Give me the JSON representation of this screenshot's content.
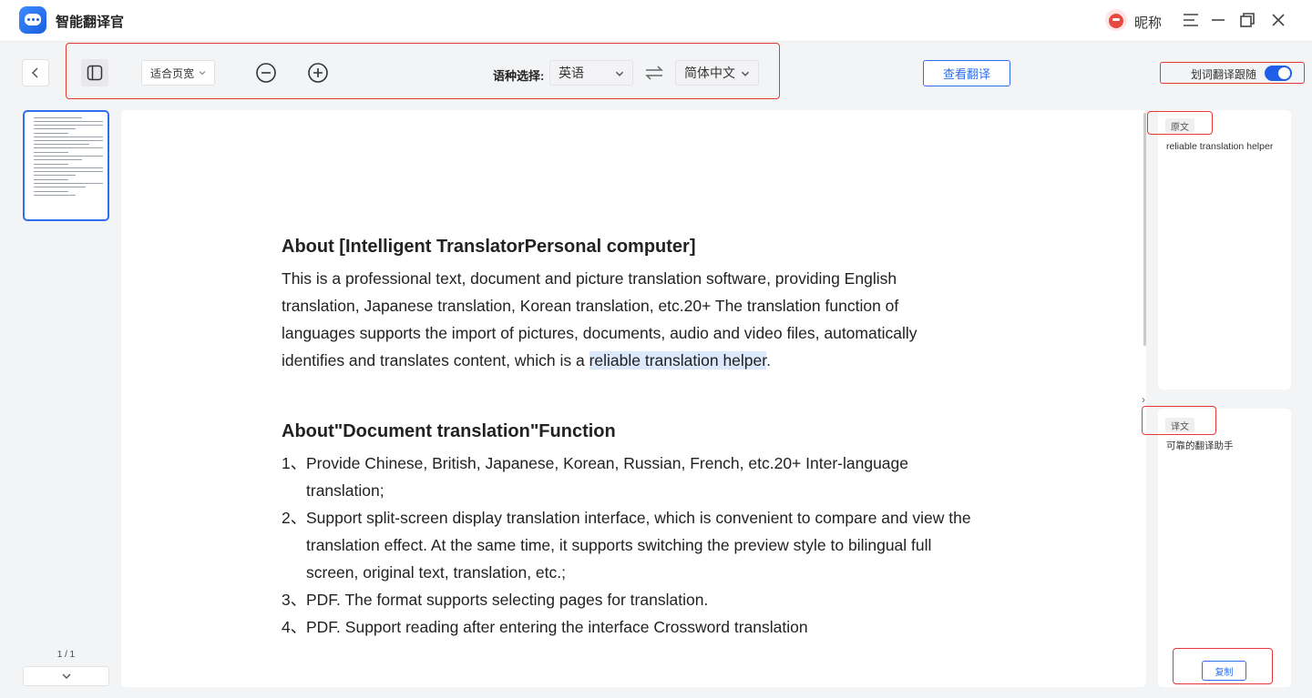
{
  "app": {
    "title": "智能翻译官",
    "user_nickname": "昵称",
    "window_buttons": [
      "menu-icon",
      "minimize-icon",
      "maximize-icon",
      "close-icon"
    ]
  },
  "toolbar": {
    "fit_mode": "适合页宽",
    "lang_label": "语种选择:",
    "source_lang": "英语",
    "target_lang": "简体中文",
    "view_translation": "查看翻译",
    "follow_label": "划词翻译跟随",
    "follow_enabled": true
  },
  "thumbnails": {
    "page_indicator": "1 / 1"
  },
  "document": {
    "section1": {
      "heading": "About [Intelligent TranslatorPersonal computer]",
      "para_before": "This is a professional text, document and picture translation software, providing English translation, Japanese translation, Korean translation, etc.20+ The translation function of languages supports the import of pictures, documents, audio and video files, automatically identifies and translates content, which is a ",
      "highlight": "reliable translation helper",
      "para_after": "."
    },
    "section2": {
      "heading": "About\"Document translation\"Function",
      "items": [
        {
          "num": "1、",
          "text": "Provide Chinese, British, Japanese, Korean, Russian, French, etc.20+ Inter-language translation;"
        },
        {
          "num": "2、",
          "text": "Support split-screen display translation interface, which is convenient to compare and view the translation effect. At the same time, it supports switching the preview style to bilingual full screen, original text, translation, etc.;"
        },
        {
          "num": "3、",
          "text": "PDF. The format supports selecting pages for translation."
        },
        {
          "num": "4、",
          "text": "PDF. Support reading after entering the interface Crossword translation"
        }
      ]
    }
  },
  "side_panel": {
    "original_tag": "原文",
    "original_text": "reliable translation helper",
    "translation_tag": "译文",
    "translation_text": "可靠的翻译助手",
    "copy_button": "复制"
  },
  "colors": {
    "accent": "#2f6ef0",
    "highlight_box": "#e53935",
    "selection": "#dce8fb"
  }
}
